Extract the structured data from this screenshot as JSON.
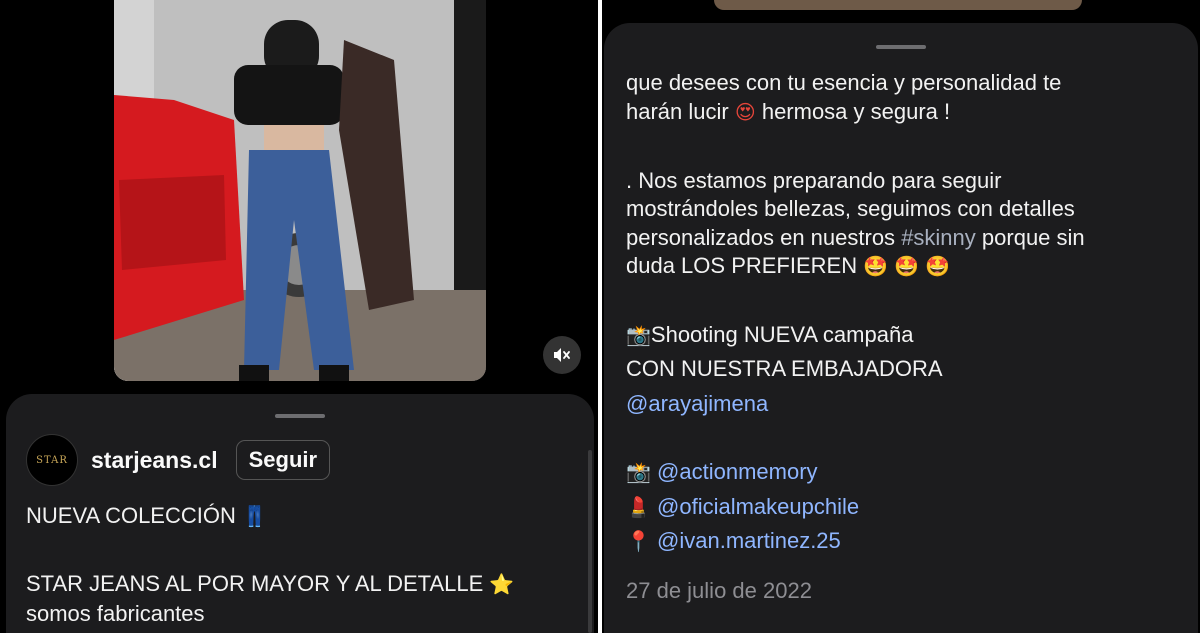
{
  "left_post": {
    "username": "starjeans.cl",
    "follow_label": "Seguir",
    "avatar_text": "STAR",
    "caption_line1": "NUEVA COLECCIÓN",
    "caption_line2": "STAR JEANS AL POR MAYOR Y AL DETALLE",
    "caption_line3": "somos fabricantes",
    "mute_icon": "muted-speaker-icon"
  },
  "right_caption": {
    "line1": "que desees con tu esencia y personalidad te",
    "line2a": "harán lucir",
    "line2b": "hermosa y segura !",
    "line3": ". Nos estamos preparando para seguir",
    "line4": "mostrándoles bellezas, seguimos con detalles",
    "line5a": "personalizados en nuestros",
    "hashtag": "#skinny",
    "line5b": "porque sin",
    "line6": "duda LOS PREFIEREN",
    "line7": "Shooting NUEVA campaña",
    "line8": " CON NUESTRA EMBAJADORA",
    "mention1": "@arayajimena",
    "mention2": "@actionmemory",
    "mention3": "@oficialmakeupchile",
    "mention4": "@ivan.martinez.25",
    "date": "27 de julio de 2022"
  },
  "colors": {
    "background": "#000000",
    "sheet": "#1c1c1e",
    "link": "#8fb6ff",
    "muted_text": "#8e8e93"
  }
}
